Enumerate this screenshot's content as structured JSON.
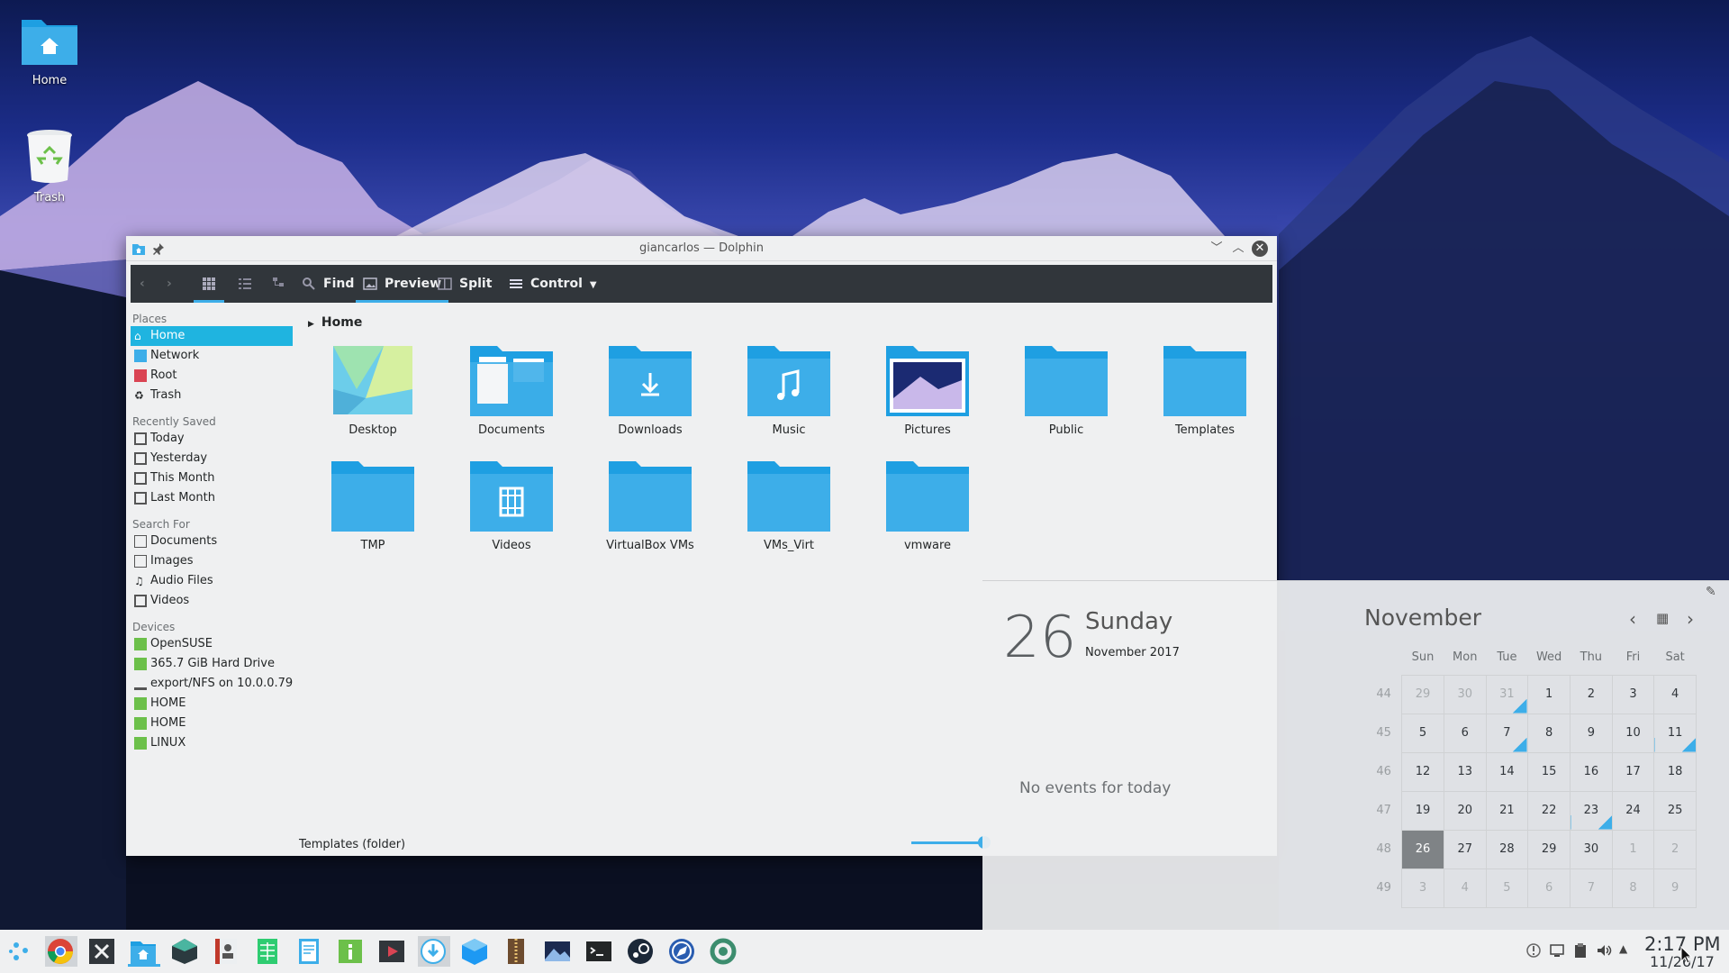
{
  "desktop": {
    "icons": [
      {
        "label": "Home",
        "icon": "folder-home-icon"
      },
      {
        "label": "Trash",
        "icon": "trash-icon"
      }
    ]
  },
  "window": {
    "title": "giancarlos — Dolphin",
    "toolbar": {
      "find": "Find",
      "preview": "Preview",
      "split": "Split",
      "control": "Control"
    },
    "places": {
      "places_header": "Places",
      "places": [
        "Home",
        "Network",
        "Root",
        "Trash"
      ],
      "recent_header": "Recently Saved",
      "recent": [
        "Today",
        "Yesterday",
        "This Month",
        "Last Month"
      ],
      "search_header": "Search For",
      "search": [
        "Documents",
        "Images",
        "Audio Files",
        "Videos"
      ],
      "devices_header": "Devices",
      "devices": [
        "OpenSUSE",
        "365.7 GiB Hard Drive",
        "export/NFS on 10.0.0.79",
        "HOME",
        "HOME",
        "LINUX"
      ]
    },
    "breadcrumb": "Home",
    "folders": [
      "Desktop",
      "Documents",
      "Downloads",
      "Music",
      "Pictures",
      "Public",
      "Templates",
      "TMP",
      "Videos",
      "VirtualBox VMs",
      "VMs_Virt",
      "vmware"
    ],
    "status": "Templates (folder)"
  },
  "calendar": {
    "day_number": "26",
    "weekday": "Sunday",
    "month_year": "November 2017",
    "no_events": "No events for today",
    "month": "November",
    "headers": [
      "Sun",
      "Mon",
      "Tue",
      "Wed",
      "Thu",
      "Fri",
      "Sat"
    ],
    "weeks": [
      {
        "wk": "44",
        "days": [
          "29",
          "30",
          "31",
          "1",
          "2",
          "3",
          "4"
        ]
      },
      {
        "wk": "45",
        "days": [
          "5",
          "6",
          "7",
          "8",
          "9",
          "10",
          "11"
        ]
      },
      {
        "wk": "46",
        "days": [
          "12",
          "13",
          "14",
          "15",
          "16",
          "17",
          "18"
        ]
      },
      {
        "wk": "47",
        "days": [
          "19",
          "20",
          "21",
          "22",
          "23",
          "24",
          "25"
        ]
      },
      {
        "wk": "48",
        "days": [
          "26",
          "27",
          "28",
          "29",
          "30",
          "1",
          "2"
        ]
      },
      {
        "wk": "49",
        "days": [
          "3",
          "4",
          "5",
          "6",
          "7",
          "8",
          "9"
        ]
      }
    ]
  },
  "taskbar": {
    "time": "2:17 PM",
    "date": "11/26/17"
  },
  "colors": {
    "accent": "#3daee9",
    "selection": "#1fb4e0",
    "toolbar_bg": "#31363b",
    "folder": "#29b6f6"
  }
}
